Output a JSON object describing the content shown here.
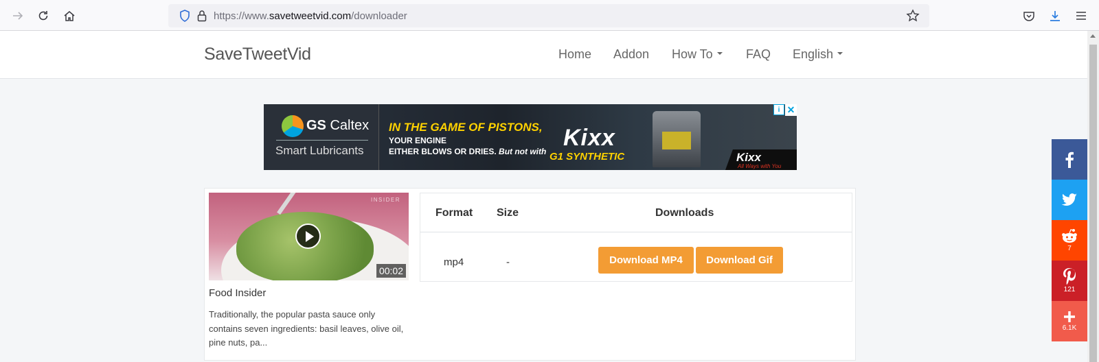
{
  "browser": {
    "url_prefix": "https://www.",
    "url_host": "savetweetvid.com",
    "url_path": "/downloader"
  },
  "navbar": {
    "brand": "SaveTweetVid",
    "links": [
      "Home",
      "Addon",
      "How To",
      "FAQ",
      "English"
    ]
  },
  "ad": {
    "brand": "GS",
    "brand_rest": " Caltex",
    "tagline": "Smart Lubricants",
    "headline": "IN THE GAME OF PISTONS,",
    "line1": "YOUR ENGINE",
    "line2": "EITHER BLOWS OR DRIES.",
    "line2_italic": " But not with",
    "product": "Kixx",
    "product_sub": "G1 SYNTHETIC",
    "corner_logo": "Kixx",
    "corner_sub": "All Ways with You"
  },
  "video": {
    "watermark": "INSIDER",
    "duration": "00:02",
    "title": "Food Insider",
    "description": "Traditionally, the popular pasta sauce only contains seven ingredients: basil leaves, olive oil, pine nuts, pa..."
  },
  "downloads": {
    "headers": [
      "Format",
      "Size",
      "Downloads"
    ],
    "row": {
      "format": "mp4",
      "size": "-"
    },
    "mp4_button": "Download MP4",
    "gif_button": "Download Gif"
  },
  "share": {
    "colors": {
      "facebook": "#3b5998",
      "twitter": "#1da1f2",
      "reddit": "#ff4500",
      "pinterest": "#cb2027",
      "more": "#f15b4b"
    },
    "reddit_count": "7",
    "pinterest_count": "121",
    "more_count": "6.1K"
  },
  "colors": {
    "accent_button": "#f39c34"
  }
}
